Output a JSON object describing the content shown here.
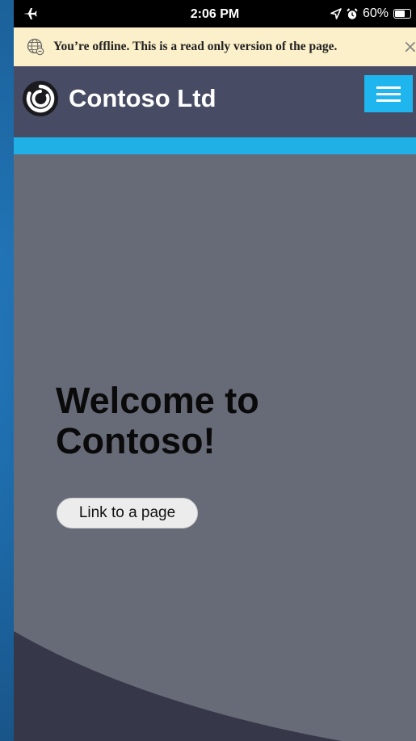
{
  "status_bar": {
    "time": "2:06 PM",
    "battery_percent": "60%",
    "icons": [
      "airplane-icon",
      "location-icon",
      "alarm-icon",
      "battery-icon"
    ]
  },
  "offline_banner": {
    "message": "You’re offline. This is a read only version of the page.",
    "close_glyph": "×",
    "icons": [
      "globe-icon",
      "close-icon"
    ]
  },
  "header": {
    "site_title": "Contoso Ltd",
    "icons": [
      "contoso-logo-icon",
      "hamburger-menu-icon"
    ],
    "menu_color": "#1fb6ef",
    "background_color": "#474b63"
  },
  "accent_bar": {
    "color": "#21b0e5"
  },
  "hero": {
    "title": "Welcome to Contoso!",
    "link_label": "Link to a page",
    "background_color": "#676a77",
    "curve_color": "#363849"
  }
}
